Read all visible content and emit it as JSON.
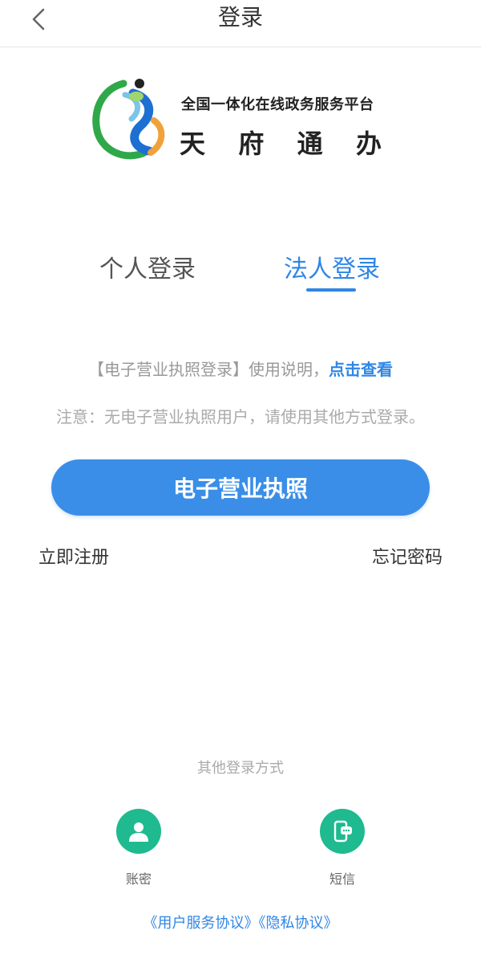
{
  "header": {
    "title": "登录",
    "back_icon": "chevron-left-icon"
  },
  "brand": {
    "subtitle": "全国一体化在线政务服务平台",
    "name_chars": [
      "天",
      "府",
      "通",
      "办"
    ],
    "logo_icon": "tianfu-logo-icon"
  },
  "tabs": [
    {
      "label": "个人登录",
      "active": false
    },
    {
      "label": "法人登录",
      "active": true
    }
  ],
  "instruction": {
    "text": "【电子营业执照登录】使用说明，",
    "link": "点击查看"
  },
  "notice": "注意：无电子营业执照用户，请使用其他方式登录。",
  "primary_button": "电子营业执照",
  "links": {
    "register": "立即注册",
    "forgot": "忘记密码"
  },
  "other_login": {
    "title": "其他登录方式",
    "methods": [
      {
        "label": "账密",
        "icon": "user-icon"
      },
      {
        "label": "短信",
        "icon": "sms-icon"
      }
    ]
  },
  "agreements": {
    "user_service": "《用户服务协议》",
    "privacy": "《隐私协议》"
  },
  "colors": {
    "accent": "#2f86e6",
    "button": "#3a8ee8",
    "method": "#1fba8f"
  }
}
